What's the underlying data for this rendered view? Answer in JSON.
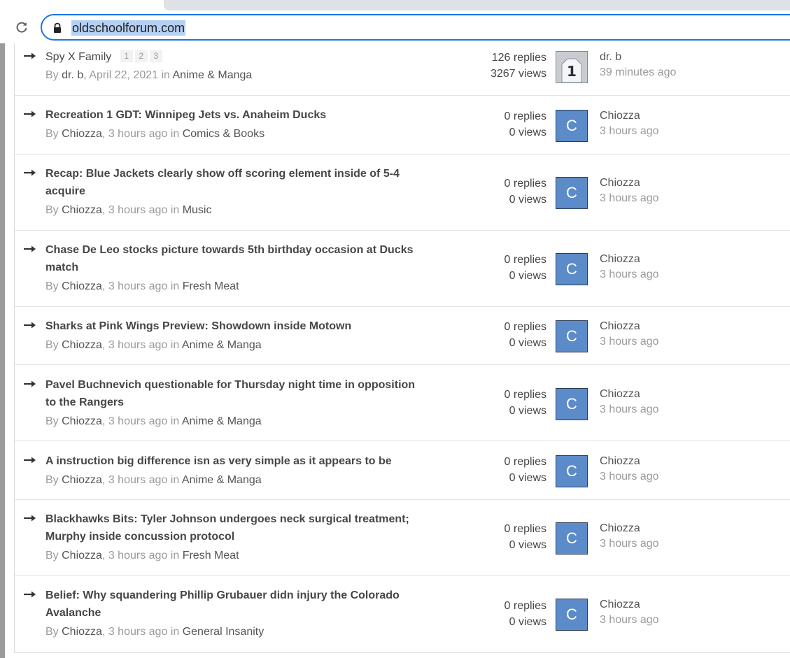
{
  "browser": {
    "url": "oldschoolforum.com"
  },
  "topics": [
    {
      "title": "Spy X Family",
      "pages": [
        "1",
        "2",
        "3"
      ],
      "by_label": "By",
      "author": "dr. b",
      "date": "April 22, 2021",
      "in_label": "in",
      "forum": "Anime & Manga",
      "replies": "126 replies",
      "views": "3267 views",
      "last_author": "dr. b",
      "last_time": "39 minutes ago",
      "avatar_letter": "1"
    },
    {
      "title": "Recreation 1 GDT: Winnipeg Jets vs.  Anaheim Ducks",
      "by_label": "By",
      "author": "Chiozza",
      "date": "3 hours ago",
      "in_label": "in",
      "forum": "Comics & Books",
      "replies": "0 replies",
      "views": "0 views",
      "last_author": "Chiozza",
      "last_time": "3 hours ago",
      "avatar_letter": "C"
    },
    {
      "title": "Recap: Blue Jackets clearly show off scoring element inside of 5-4 acquire",
      "by_label": "By",
      "author": "Chiozza",
      "date": "3 hours ago",
      "in_label": "in",
      "forum": "Music",
      "replies": "0 replies",
      "views": "0 views",
      "last_author": "Chiozza",
      "last_time": "3 hours ago",
      "avatar_letter": "C"
    },
    {
      "title": "Chase De Leo stocks picture towards 5th birthday occasion at Ducks match",
      "by_label": "By",
      "author": "Chiozza",
      "date": "3 hours ago",
      "in_label": "in",
      "forum": "Fresh Meat",
      "replies": "0 replies",
      "views": "0 views",
      "last_author": "Chiozza",
      "last_time": "3 hours ago",
      "avatar_letter": "C"
    },
    {
      "title": "Sharks at Pink Wings Preview: Showdown inside Motown",
      "by_label": "By",
      "author": "Chiozza",
      "date": "3 hours ago",
      "in_label": "in",
      "forum": "Anime & Manga",
      "replies": "0 replies",
      "views": "0 views",
      "last_author": "Chiozza",
      "last_time": "3 hours ago",
      "avatar_letter": "C"
    },
    {
      "title": "Pavel Buchnevich questionable for Thursday night time in opposition to the Rangers",
      "by_label": "By",
      "author": "Chiozza",
      "date": "3 hours ago",
      "in_label": "in",
      "forum": "Anime & Manga",
      "replies": "0 replies",
      "views": "0 views",
      "last_author": "Chiozza",
      "last_time": "3 hours ago",
      "avatar_letter": "C"
    },
    {
      "title": "A instruction big difference isn as very simple as it appears to be",
      "by_label": "By",
      "author": "Chiozza",
      "date": "3 hours ago",
      "in_label": "in",
      "forum": "Anime & Manga",
      "replies": "0 replies",
      "views": "0 views",
      "last_author": "Chiozza",
      "last_time": "3 hours ago",
      "avatar_letter": "C"
    },
    {
      "title": "Blackhawks Bits: Tyler Johnson undergoes neck surgical treatment; Murphy inside concussion protocol",
      "by_label": "By",
      "author": "Chiozza",
      "date": "3 hours ago",
      "in_label": "in",
      "forum": "Fresh Meat",
      "replies": "0 replies",
      "views": "0 views",
      "last_author": "Chiozza",
      "last_time": "3 hours ago",
      "avatar_letter": "C"
    },
    {
      "title": "Belief: Why squandering Phillip Grubauer didn injury the Colorado Avalanche",
      "by_label": "By",
      "author": "Chiozza",
      "date": "3 hours ago",
      "in_label": "in",
      "forum": "General Insanity",
      "replies": "0 replies",
      "views": "0 views",
      "last_author": "Chiozza",
      "last_time": "3 hours ago",
      "avatar_letter": "C"
    }
  ]
}
